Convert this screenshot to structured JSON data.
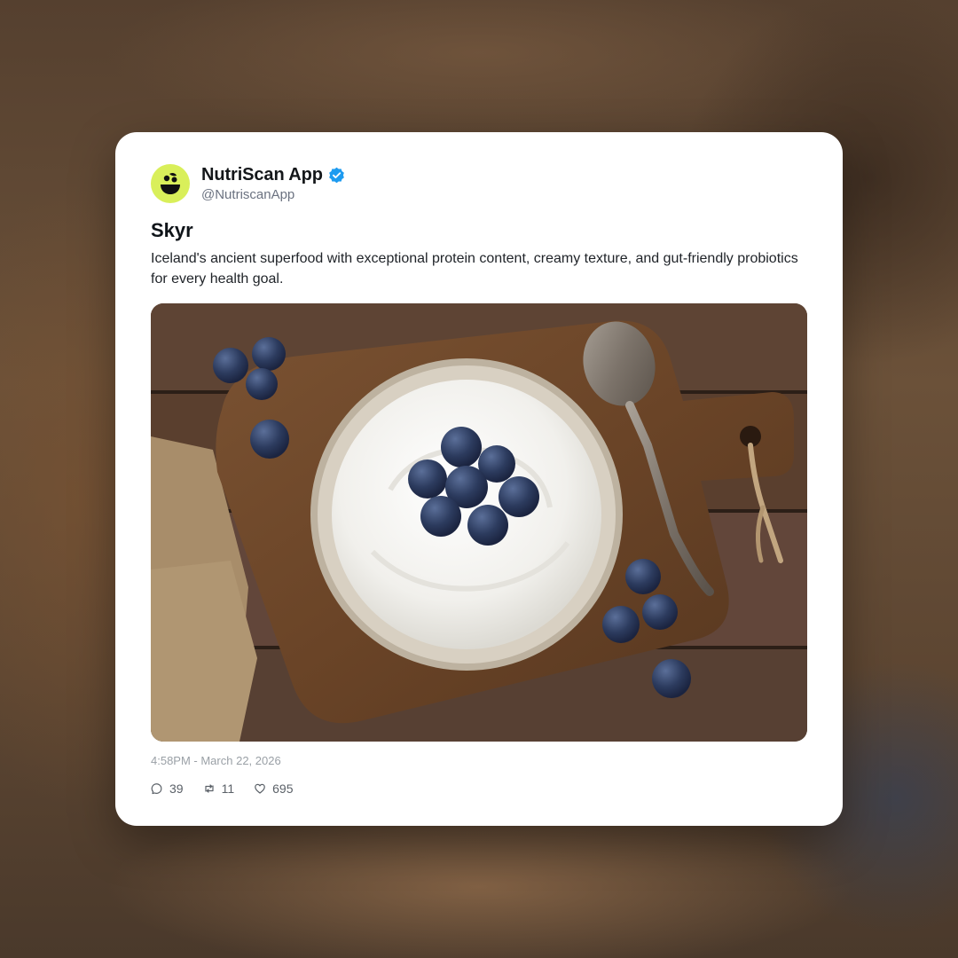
{
  "account": {
    "name": "NutriScan App",
    "handle": "@NutriscanApp",
    "verified_icon": "verified-badge-icon",
    "accent_color": "#1d9bf0",
    "avatar_color": "#d9ef5a"
  },
  "post": {
    "title": "Skyr",
    "text": "Iceland's ancient superfood with exceptional protein content, creamy texture, and gut-friendly probiotics for every health goal.",
    "image_icon": "food-photo",
    "timestamp": "4:58PM - March 22, 2026"
  },
  "stats": {
    "replies": "39",
    "reposts": "11",
    "likes": "695",
    "reply_icon": "comment-icon",
    "repost_icon": "repost-icon",
    "like_icon": "heart-icon"
  }
}
